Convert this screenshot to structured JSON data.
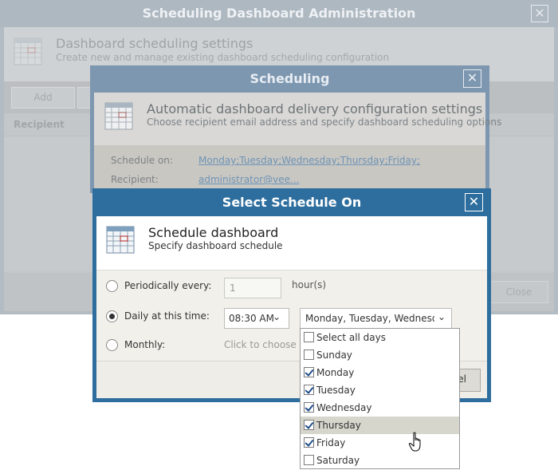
{
  "window_main": {
    "title": "Scheduling Dashboard Administration",
    "close": "✕",
    "heading": "Dashboard scheduling settings",
    "subheading": "Create new and manage existing dashboard scheduling configuration",
    "toolbar": {
      "add_label": "Add"
    },
    "columns": [
      "Recipient"
    ],
    "close_label": "Close"
  },
  "window_scheduling": {
    "title": "Scheduling",
    "close": "✕",
    "heading": "Automatic dashboard delivery configuration settings",
    "subheading": "Choose recipient email address and specify dashboard scheduling options",
    "fields": {
      "schedule_label": "Schedule on:",
      "schedule_value": "Monday;Tuesday;Wednesday;Thursday;Friday;",
      "recipient_label": "Recipient:",
      "recipient_value": "administrator@vee..."
    }
  },
  "window_select": {
    "title": "Select Schedule On",
    "close": "✕",
    "heading": "Schedule dashboard",
    "subheading": "Specify dashboard schedule",
    "periodic": {
      "label": "Periodically every:",
      "value": "1",
      "unit": "hour(s)",
      "selected": false
    },
    "daily": {
      "label": "Daily at this time:",
      "time": "08:30 AM",
      "days_summary": "Monday, Tuesday, Wednesday, Thursday, Friday",
      "selected": true
    },
    "monthly": {
      "label": "Monthly:",
      "link": "Click to choose",
      "selected": false
    },
    "cancel_label": "el",
    "dropdown_chevron": "⌄"
  },
  "days_dropdown": {
    "items": [
      {
        "label": "Select all days",
        "checked": false
      },
      {
        "label": "Sunday",
        "checked": false
      },
      {
        "label": "Monday",
        "checked": true
      },
      {
        "label": "Tuesday",
        "checked": true
      },
      {
        "label": "Wednesday",
        "checked": true
      },
      {
        "label": "Thursday",
        "checked": true,
        "highlighted": true
      },
      {
        "label": "Friday",
        "checked": true
      },
      {
        "label": "Saturday",
        "checked": false
      }
    ]
  },
  "icons": {
    "window_icon": "calendar-icon",
    "cursor": "hand-pointer-icon"
  },
  "colors": {
    "active_titlebar": "#2e6e9e",
    "link": "#6d93b6",
    "checkmark": "#1f4e8c"
  }
}
